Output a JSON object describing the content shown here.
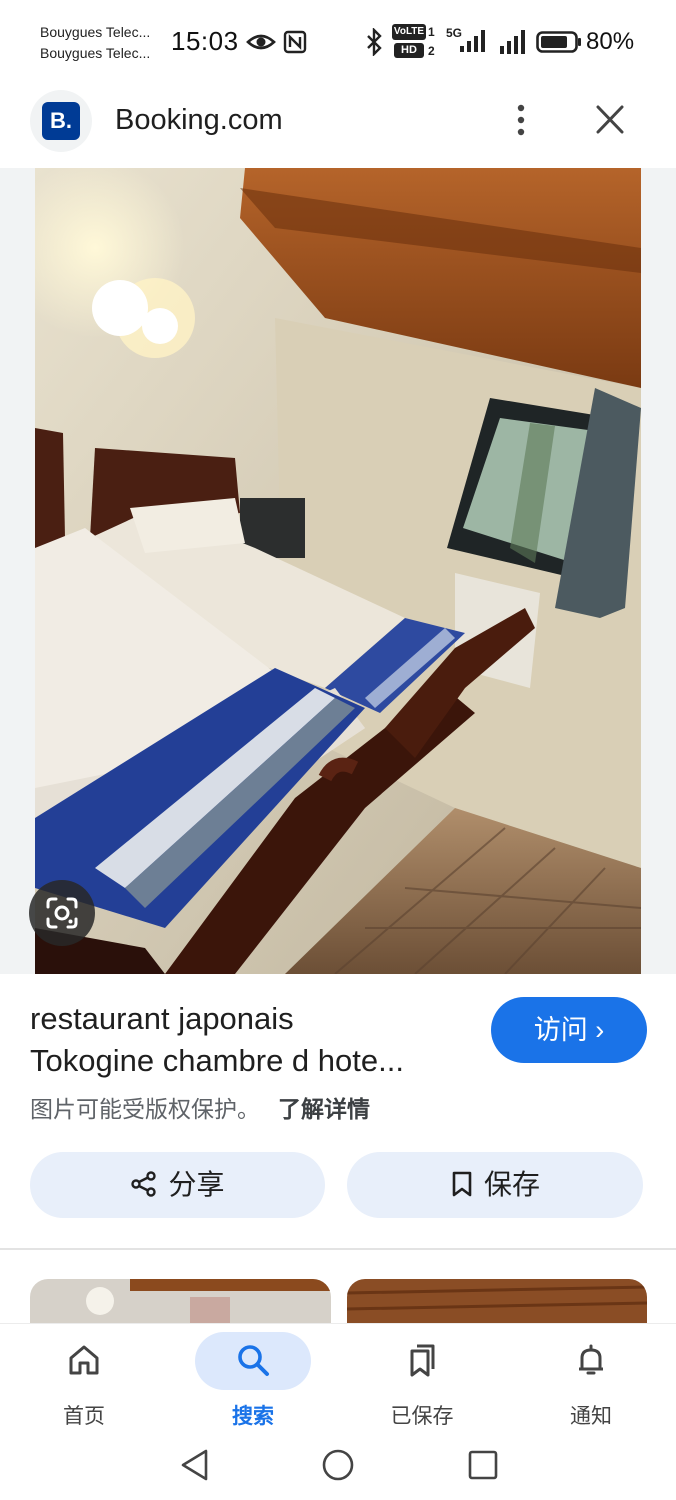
{
  "status_bar": {
    "carrier_1": "Bouygues Telec...",
    "carrier_2": "Bouygues Telec...",
    "time": "15:03",
    "volte": "VoLTE",
    "hd": "HD",
    "sim_1": "1",
    "sim_2": "2",
    "network": "5G",
    "battery": "80%",
    "battery_level": 0.8
  },
  "header": {
    "logo_text": "B.",
    "site_name": "Booking.com",
    "icons": [
      "more-vert-icon",
      "close-icon"
    ]
  },
  "image": {
    "lens_icon": "google-lens-icon"
  },
  "result": {
    "title_line_1": "restaurant japonais",
    "title_line_2": "Tokogine chambre d hote...",
    "visit_label": "访问 ›",
    "copyright_text": "图片可能受版权保护。",
    "learn_more": "了解详情"
  },
  "actions": {
    "share_label": "分享",
    "save_label": "保存"
  },
  "bottom_nav": {
    "items": [
      {
        "label": "首页",
        "icon": "home-icon"
      },
      {
        "label": "搜索",
        "icon": "search-icon",
        "active": true
      },
      {
        "label": "已保存",
        "icon": "bookmarks-icon"
      },
      {
        "label": "通知",
        "icon": "bell-icon"
      }
    ]
  },
  "colors": {
    "accent": "#1a73e8",
    "action_bg": "#e8effa",
    "booking_blue": "#003b95"
  }
}
